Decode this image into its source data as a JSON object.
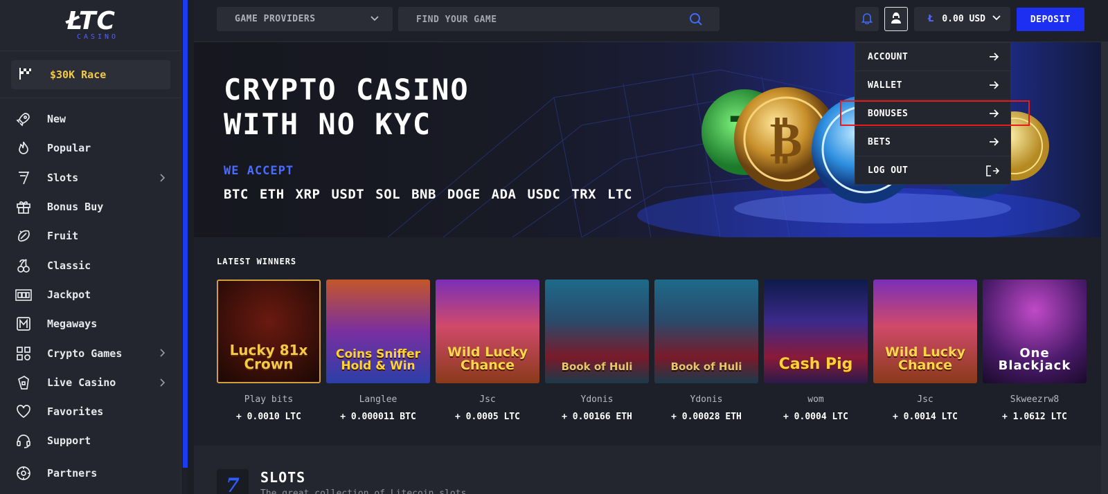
{
  "logo": {
    "main": "ŁTC",
    "sub": "CASINO"
  },
  "race": {
    "label": "$30K Race"
  },
  "sidebar": {
    "items": [
      {
        "label": "New",
        "icon": "rocket-icon",
        "expandable": false
      },
      {
        "label": "Popular",
        "icon": "flame-icon",
        "expandable": false
      },
      {
        "label": "Slots",
        "icon": "seven-icon",
        "expandable": true
      },
      {
        "label": "Bonus Buy",
        "icon": "gift-icon",
        "expandable": false
      },
      {
        "label": "Fruit",
        "icon": "fruit-icon",
        "expandable": false
      },
      {
        "label": "Classic",
        "icon": "cherry-icon",
        "expandable": false
      },
      {
        "label": "Jackpot",
        "icon": "jackpot-icon",
        "expandable": false
      },
      {
        "label": "Megaways",
        "icon": "megaways-icon",
        "expandable": false
      },
      {
        "label": "Crypto Games",
        "icon": "grid-icon",
        "expandable": true
      },
      {
        "label": "Live Casino",
        "icon": "live-icon",
        "expandable": true
      },
      {
        "label": "Favorites",
        "icon": "heart-icon",
        "expandable": false
      },
      {
        "label": "Support",
        "icon": "headset-icon",
        "expandable": false
      },
      {
        "label": "Partners",
        "icon": "partners-icon",
        "expandable": false
      }
    ]
  },
  "header": {
    "providers_label": "GAME PROVIDERS",
    "search_placeholder": "FIND YOUR GAME",
    "balance": "0.00 USD",
    "deposit_label": "DEPOSIT"
  },
  "user_menu": {
    "items": [
      {
        "label": "ACCOUNT",
        "icon": "arrow-right-icon"
      },
      {
        "label": "WALLET",
        "icon": "arrow-right-icon"
      },
      {
        "label": "BONUSES",
        "icon": "arrow-right-icon"
      },
      {
        "label": "BETS",
        "icon": "arrow-right-icon"
      },
      {
        "label": "LOG OUT",
        "icon": "logout-icon"
      }
    ]
  },
  "hero": {
    "title_line1": "CRYPTO CASINO",
    "title_line2": "WITH NO KYC",
    "accept_label": "WE ACCEPT",
    "coins": [
      "BTC",
      "ETH",
      "XRP",
      "USDT",
      "SOL",
      "BNB",
      "DOGE",
      "ADA",
      "USDC",
      "TRX",
      "LTC"
    ]
  },
  "winners": {
    "title": "LATEST WINNERS",
    "items": [
      {
        "game": "Lucky 81x Crown",
        "player": "Play bits",
        "amount": "+ 0.0010 LTC"
      },
      {
        "game": "Coins Sniffer Hold & Win",
        "player": "Langlee",
        "amount": "+ 0.000011 BTC"
      },
      {
        "game": "Wild Lucky Chance",
        "player": "Jsc",
        "amount": "+ 0.0005 LTC"
      },
      {
        "game": "Book of Huli",
        "player": "Ydonis",
        "amount": "+ 0.00166 ETH"
      },
      {
        "game": "Book of Huli",
        "player": "Ydonis",
        "amount": "+ 0.00028 ETH"
      },
      {
        "game": "Cash Pig",
        "player": "wom",
        "amount": "+ 0.0004 LTC"
      },
      {
        "game": "Wild Lucky Chance",
        "player": "Jsc",
        "amount": "+ 0.0014 LTC"
      },
      {
        "game": "One Blackjack",
        "player": "Skweezrw8",
        "amount": "+ 1.0612 LTC"
      }
    ]
  },
  "slots_section": {
    "badge": "7",
    "title": "SLOTS",
    "subtitle": "The great collection of Litecoin slots"
  },
  "colors": {
    "accent": "#1d2ff0",
    "race": "#f3c94b",
    "highlight": "#e81b1b"
  }
}
